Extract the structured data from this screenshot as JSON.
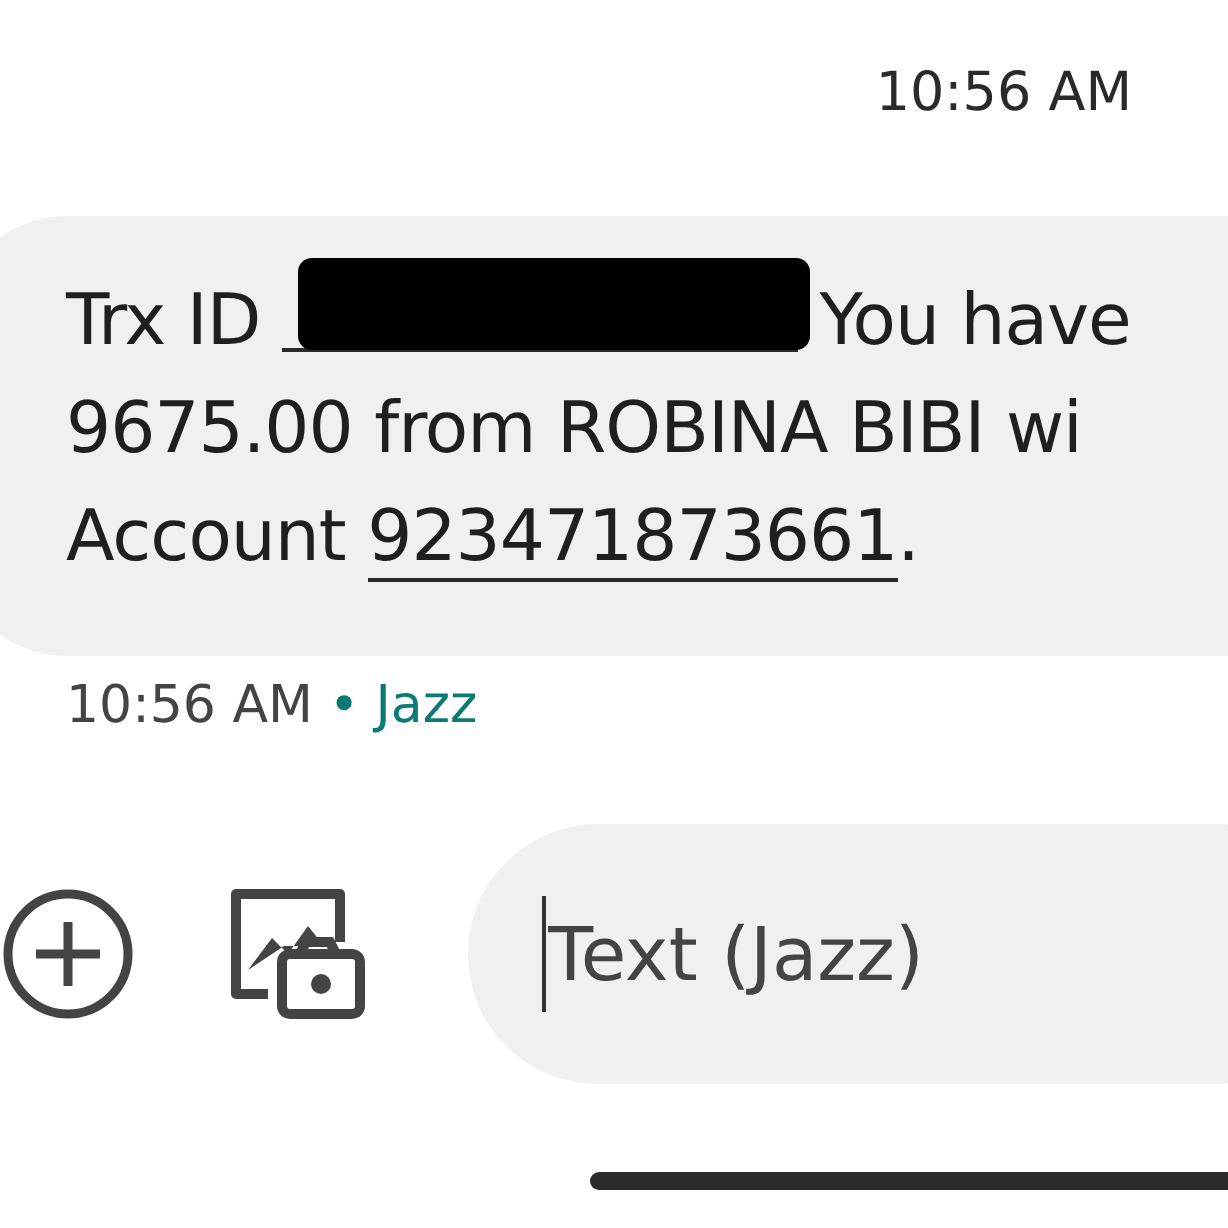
{
  "status_time": "10:56 AM",
  "message": {
    "lines": [
      [
        {
          "kind": "plain",
          "text": "Trx ID "
        },
        {
          "kind": "redaction"
        },
        {
          "kind": "plain",
          "text": " You have"
        }
      ],
      [
        {
          "kind": "plain",
          "text": "9675.00 from ROBINA BIBI wi"
        }
      ],
      [
        {
          "kind": "plain",
          "text": "Account "
        },
        {
          "kind": "link",
          "text": "923471873661"
        },
        {
          "kind": "plain",
          "text": "."
        }
      ]
    ]
  },
  "meta": {
    "time": "10:56 AM",
    "separator": "•",
    "sender": "Jazz"
  },
  "composer": {
    "placeholder": "Text (Jazz)"
  }
}
